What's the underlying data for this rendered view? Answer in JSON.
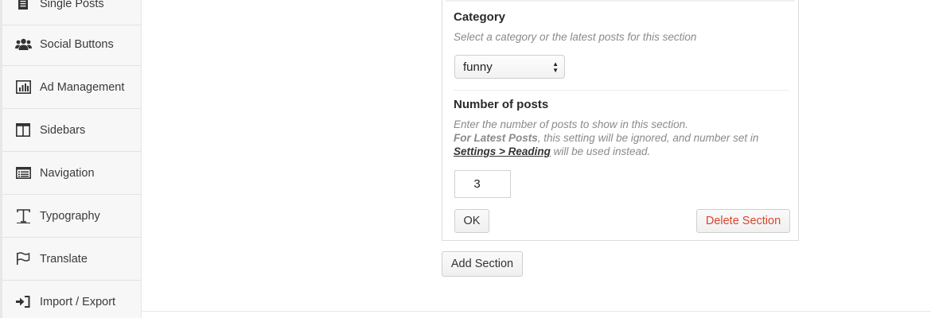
{
  "sidebar": {
    "items": [
      {
        "label": "Single Posts",
        "icon": "document-icon"
      },
      {
        "label": "Social Buttons",
        "icon": "users-icon"
      },
      {
        "label": "Ad Management",
        "icon": "bar-chart-icon"
      },
      {
        "label": "Sidebars",
        "icon": "columns-icon"
      },
      {
        "label": "Navigation",
        "icon": "list-icon"
      },
      {
        "label": "Typography",
        "icon": "text-icon"
      },
      {
        "label": "Translate",
        "icon": "flag-icon"
      },
      {
        "label": "Import / Export",
        "icon": "sign-in-icon"
      }
    ]
  },
  "section": {
    "category": {
      "title": "Category",
      "description": "Select a category or the latest posts for this section",
      "selected": "funny"
    },
    "posts": {
      "title": "Number of posts",
      "description_line1": "Enter the number of posts to show in this section.",
      "latest_label": "For Latest Posts",
      "description_line2": ", this setting will be ignored, and number set in",
      "settings_link": "Settings > Reading",
      "description_line3": " will be used instead.",
      "value": "3"
    },
    "ok_label": "OK",
    "delete_label": "Delete Section"
  },
  "add_section_label": "Add Section",
  "colors": {
    "danger": "#d9452b",
    "sidebar_bg": "#f7f7f7"
  }
}
